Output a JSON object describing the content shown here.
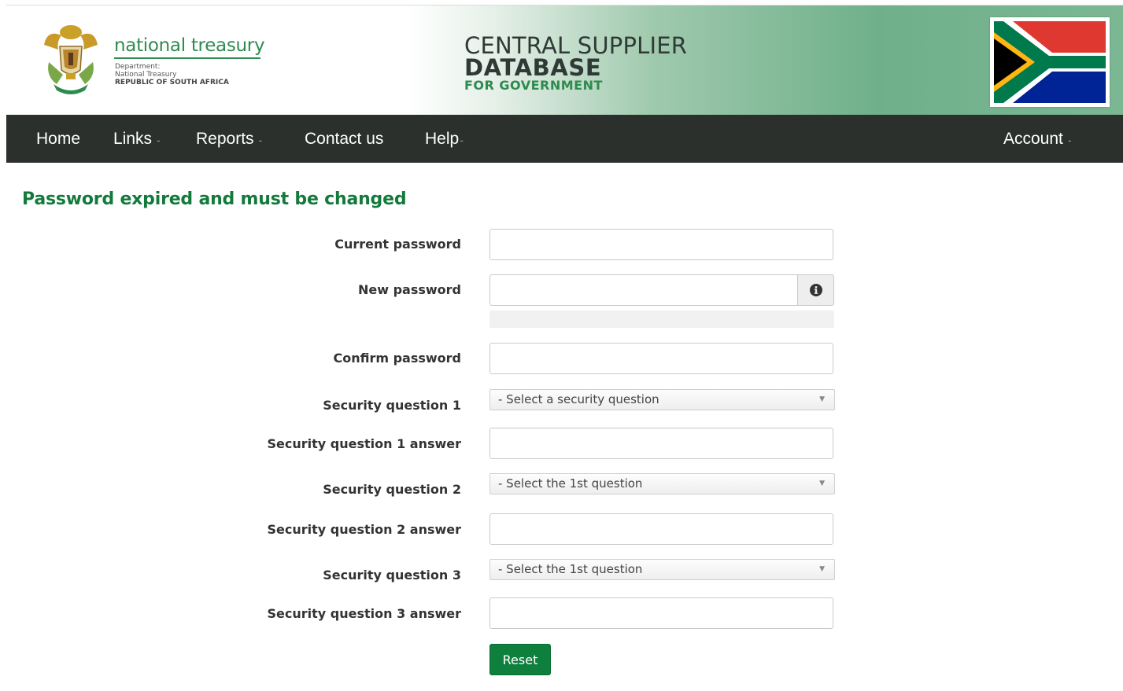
{
  "header": {
    "brand_name": "national treasury",
    "dept_line1": "Department:",
    "dept_line2": "National Treasury",
    "dept_line3": "REPUBLIC OF SOUTH AFRICA",
    "title_line1": "CENTRAL SUPPLIER",
    "title_line2": "DATABASE",
    "title_line3": "FOR GOVERNMENT",
    "colors": {
      "brand_green": "#2e8b4f",
      "title_dark": "#2f3a36"
    }
  },
  "nav": {
    "items": [
      {
        "label": "Home",
        "has_dropdown": false
      },
      {
        "label": "Links",
        "has_dropdown": true
      },
      {
        "label": "Reports",
        "has_dropdown": true
      },
      {
        "label": "Contact us",
        "has_dropdown": false
      },
      {
        "label": "Help",
        "has_dropdown": true
      }
    ],
    "account": {
      "label": "Account",
      "has_dropdown": true
    },
    "caret_glyph": "-",
    "background": "#2b302d"
  },
  "form": {
    "title": "Password expired and must be changed",
    "current_password": {
      "label": "Current password",
      "value": ""
    },
    "new_password": {
      "label": "New password",
      "value": "",
      "info_icon": "info-circle-icon",
      "strength_text": ""
    },
    "confirm_password": {
      "label": "Confirm password",
      "value": ""
    },
    "security_question_1": {
      "label": "Security question 1",
      "selected": "- Select a security question"
    },
    "security_answer_1": {
      "label": "Security question 1 answer",
      "value": ""
    },
    "security_question_2": {
      "label": "Security question 2",
      "selected": "- Select the 1st question"
    },
    "security_answer_2": {
      "label": "Security question 2 answer",
      "value": ""
    },
    "security_question_3": {
      "label": "Security question 3",
      "selected": "- Select the 1st question"
    },
    "security_answer_3": {
      "label": "Security question 3 answer",
      "value": ""
    },
    "reset_label": "Reset",
    "colors": {
      "title": "#137a3c",
      "button": "#0f7f3e"
    }
  }
}
